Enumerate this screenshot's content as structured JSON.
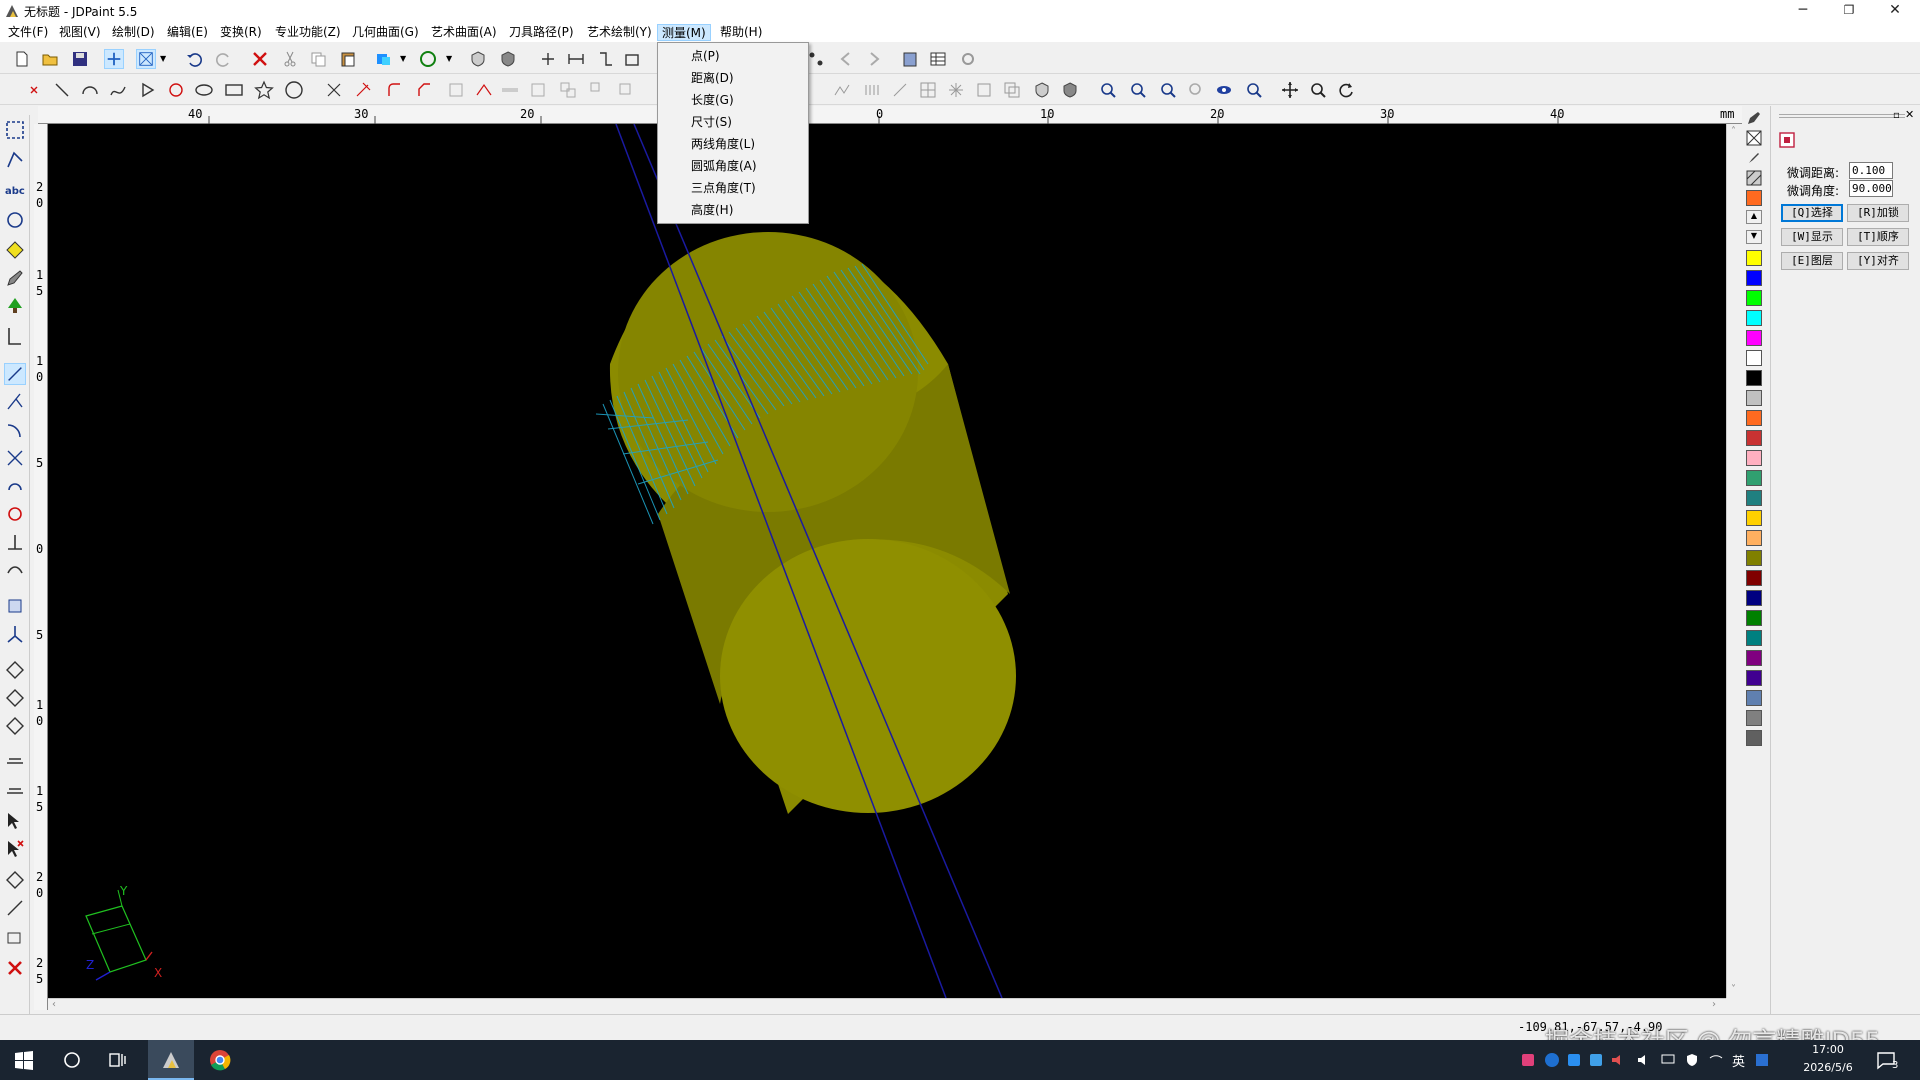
{
  "window": {
    "title": "无标题 - JDPaint 5.5",
    "minimize": "─",
    "restore": "❐",
    "close": "✕"
  },
  "menubar": [
    {
      "label": "文件(F)"
    },
    {
      "label": "视图(V)"
    },
    {
      "label": "绘制(D)"
    },
    {
      "label": "编辑(E)"
    },
    {
      "label": "变换(R)"
    },
    {
      "label": "专业功能(Z)"
    },
    {
      "label": "几何曲面(G)"
    },
    {
      "label": "艺术曲面(A)"
    },
    {
      "label": "刀具路径(P)"
    },
    {
      "label": "艺术绘制(Y)"
    },
    {
      "label": "测量(M)"
    },
    {
      "label": "帮助(H)"
    }
  ],
  "measure_menu": {
    "items": [
      "点(P)",
      "距离(D)",
      "长度(G)",
      "尺寸(S)",
      "两线角度(L)",
      "圆弧角度(A)",
      "三点角度(T)",
      "高度(H)"
    ]
  },
  "ruler": {
    "unit": "mm",
    "top_ticks": [
      "40",
      "30",
      "20",
      "0",
      "10",
      "20",
      "30",
      "40"
    ],
    "left_ticks": [
      "2",
      "0",
      "1",
      "5",
      "1",
      "0",
      "5",
      "0",
      "5",
      "1",
      "0",
      "1",
      "5",
      "2",
      "0",
      "2",
      "5"
    ]
  },
  "right_panel": {
    "fine_distance_label": "微调距离:",
    "fine_distance_value": "0.100",
    "fine_angle_label": "微调角度:",
    "fine_angle_value": "90.000",
    "buttons": [
      "[Q]选择",
      "[R]加锁",
      "[W]显示",
      "[T]顺序",
      "[E]图层",
      "[Y]对齐"
    ]
  },
  "colors": {
    "accent": "#0078d7",
    "canvas": "#000000",
    "cylinder": "#8b8b00",
    "cap": "#8f8f00",
    "toolpath": "#1fa3c8",
    "axis_line": "#1a1aa0"
  },
  "palette_colors": [
    "#ffff00",
    "#0000ff",
    "#00ff00",
    "#00ffff",
    "#ff00ff",
    "#ffffff",
    "#000000",
    "#c0c0c0",
    "#ff6a20",
    "#c83232",
    "#ffb0c0",
    "#30a070",
    "#208080",
    "#ffd000",
    "#ffb060",
    "#808000",
    "#800000",
    "#000080",
    "#008000",
    "#008080",
    "#800080",
    "#400090",
    "#6080b0",
    "#808080",
    "#606060"
  ],
  "status": {
    "coords": "-109.81,-67.57,-4.90"
  },
  "axes": {
    "y": "Y",
    "x": "X",
    "z": "Z"
  },
  "taskbar": {
    "ime": "英",
    "time": "17:00",
    "date": "2026/5/6",
    "notif_count": "3"
  },
  "watermark": "掘金技术社区 @ 勿言精雕JD55"
}
